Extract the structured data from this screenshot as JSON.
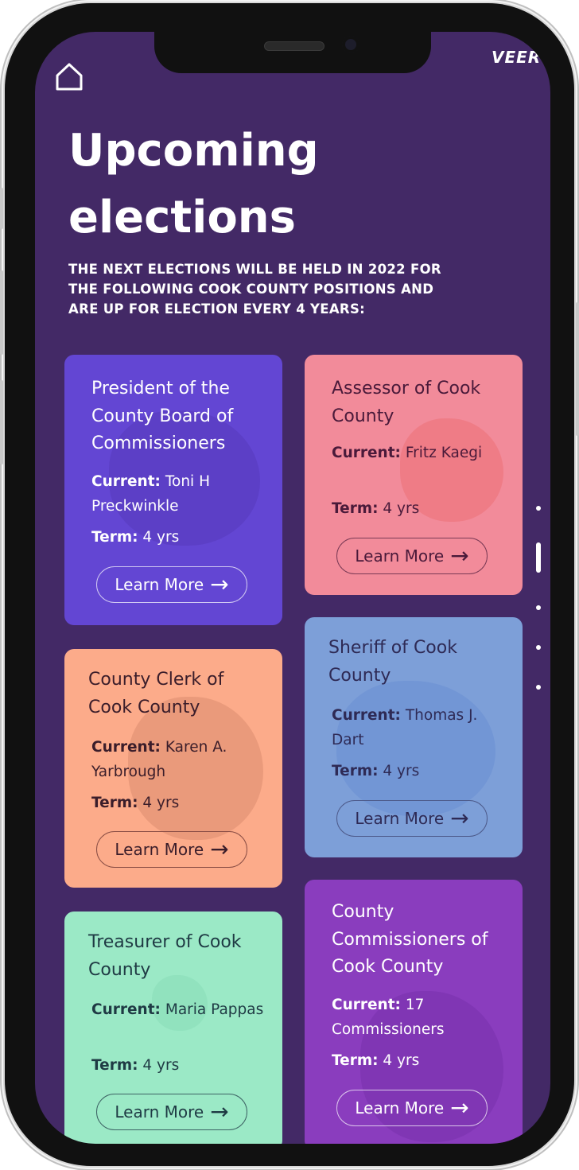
{
  "brand": "VEER",
  "title": "Upcoming elections",
  "subtitle": "THE NEXT ELECTIONS WILL BE HELD IN 2022 FOR THE FOLLOWING COOK COUNTY POSITIONS AND ARE UP FOR ELECTION EVERY 4 YEARS:",
  "labels": {
    "current": "Current:",
    "term": "Term:",
    "learn_more": "Learn More"
  },
  "cards": [
    {
      "title": "President of the County Board of Commissioners",
      "current": "Toni H Preckwinkle",
      "term": "4 yrs",
      "color": "#6346d3"
    },
    {
      "title": "Assessor of Cook County",
      "current": "Fritz Kaegi",
      "term": "4 yrs",
      "color": "#f28b9a"
    },
    {
      "title": "County Clerk of Cook County",
      "current": "Karen A. Yarbrough",
      "term": "4 yrs",
      "color": "#fcab8a"
    },
    {
      "title": "Sheriff of Cook County",
      "current": "Thomas J. Dart",
      "term": "4 yrs",
      "color": "#7d9fd8"
    },
    {
      "title": "Treasurer of Cook County",
      "current": "Maria Pappas",
      "term": "4 yrs",
      "color": "#9be9c6"
    },
    {
      "title": "County Commissioners of Cook County",
      "current": "17 Commissioners",
      "term": "4 yrs",
      "color": "#8a3dbe"
    }
  ],
  "icons": {
    "home": "home-icon",
    "arrow": "arrow-right-icon"
  }
}
